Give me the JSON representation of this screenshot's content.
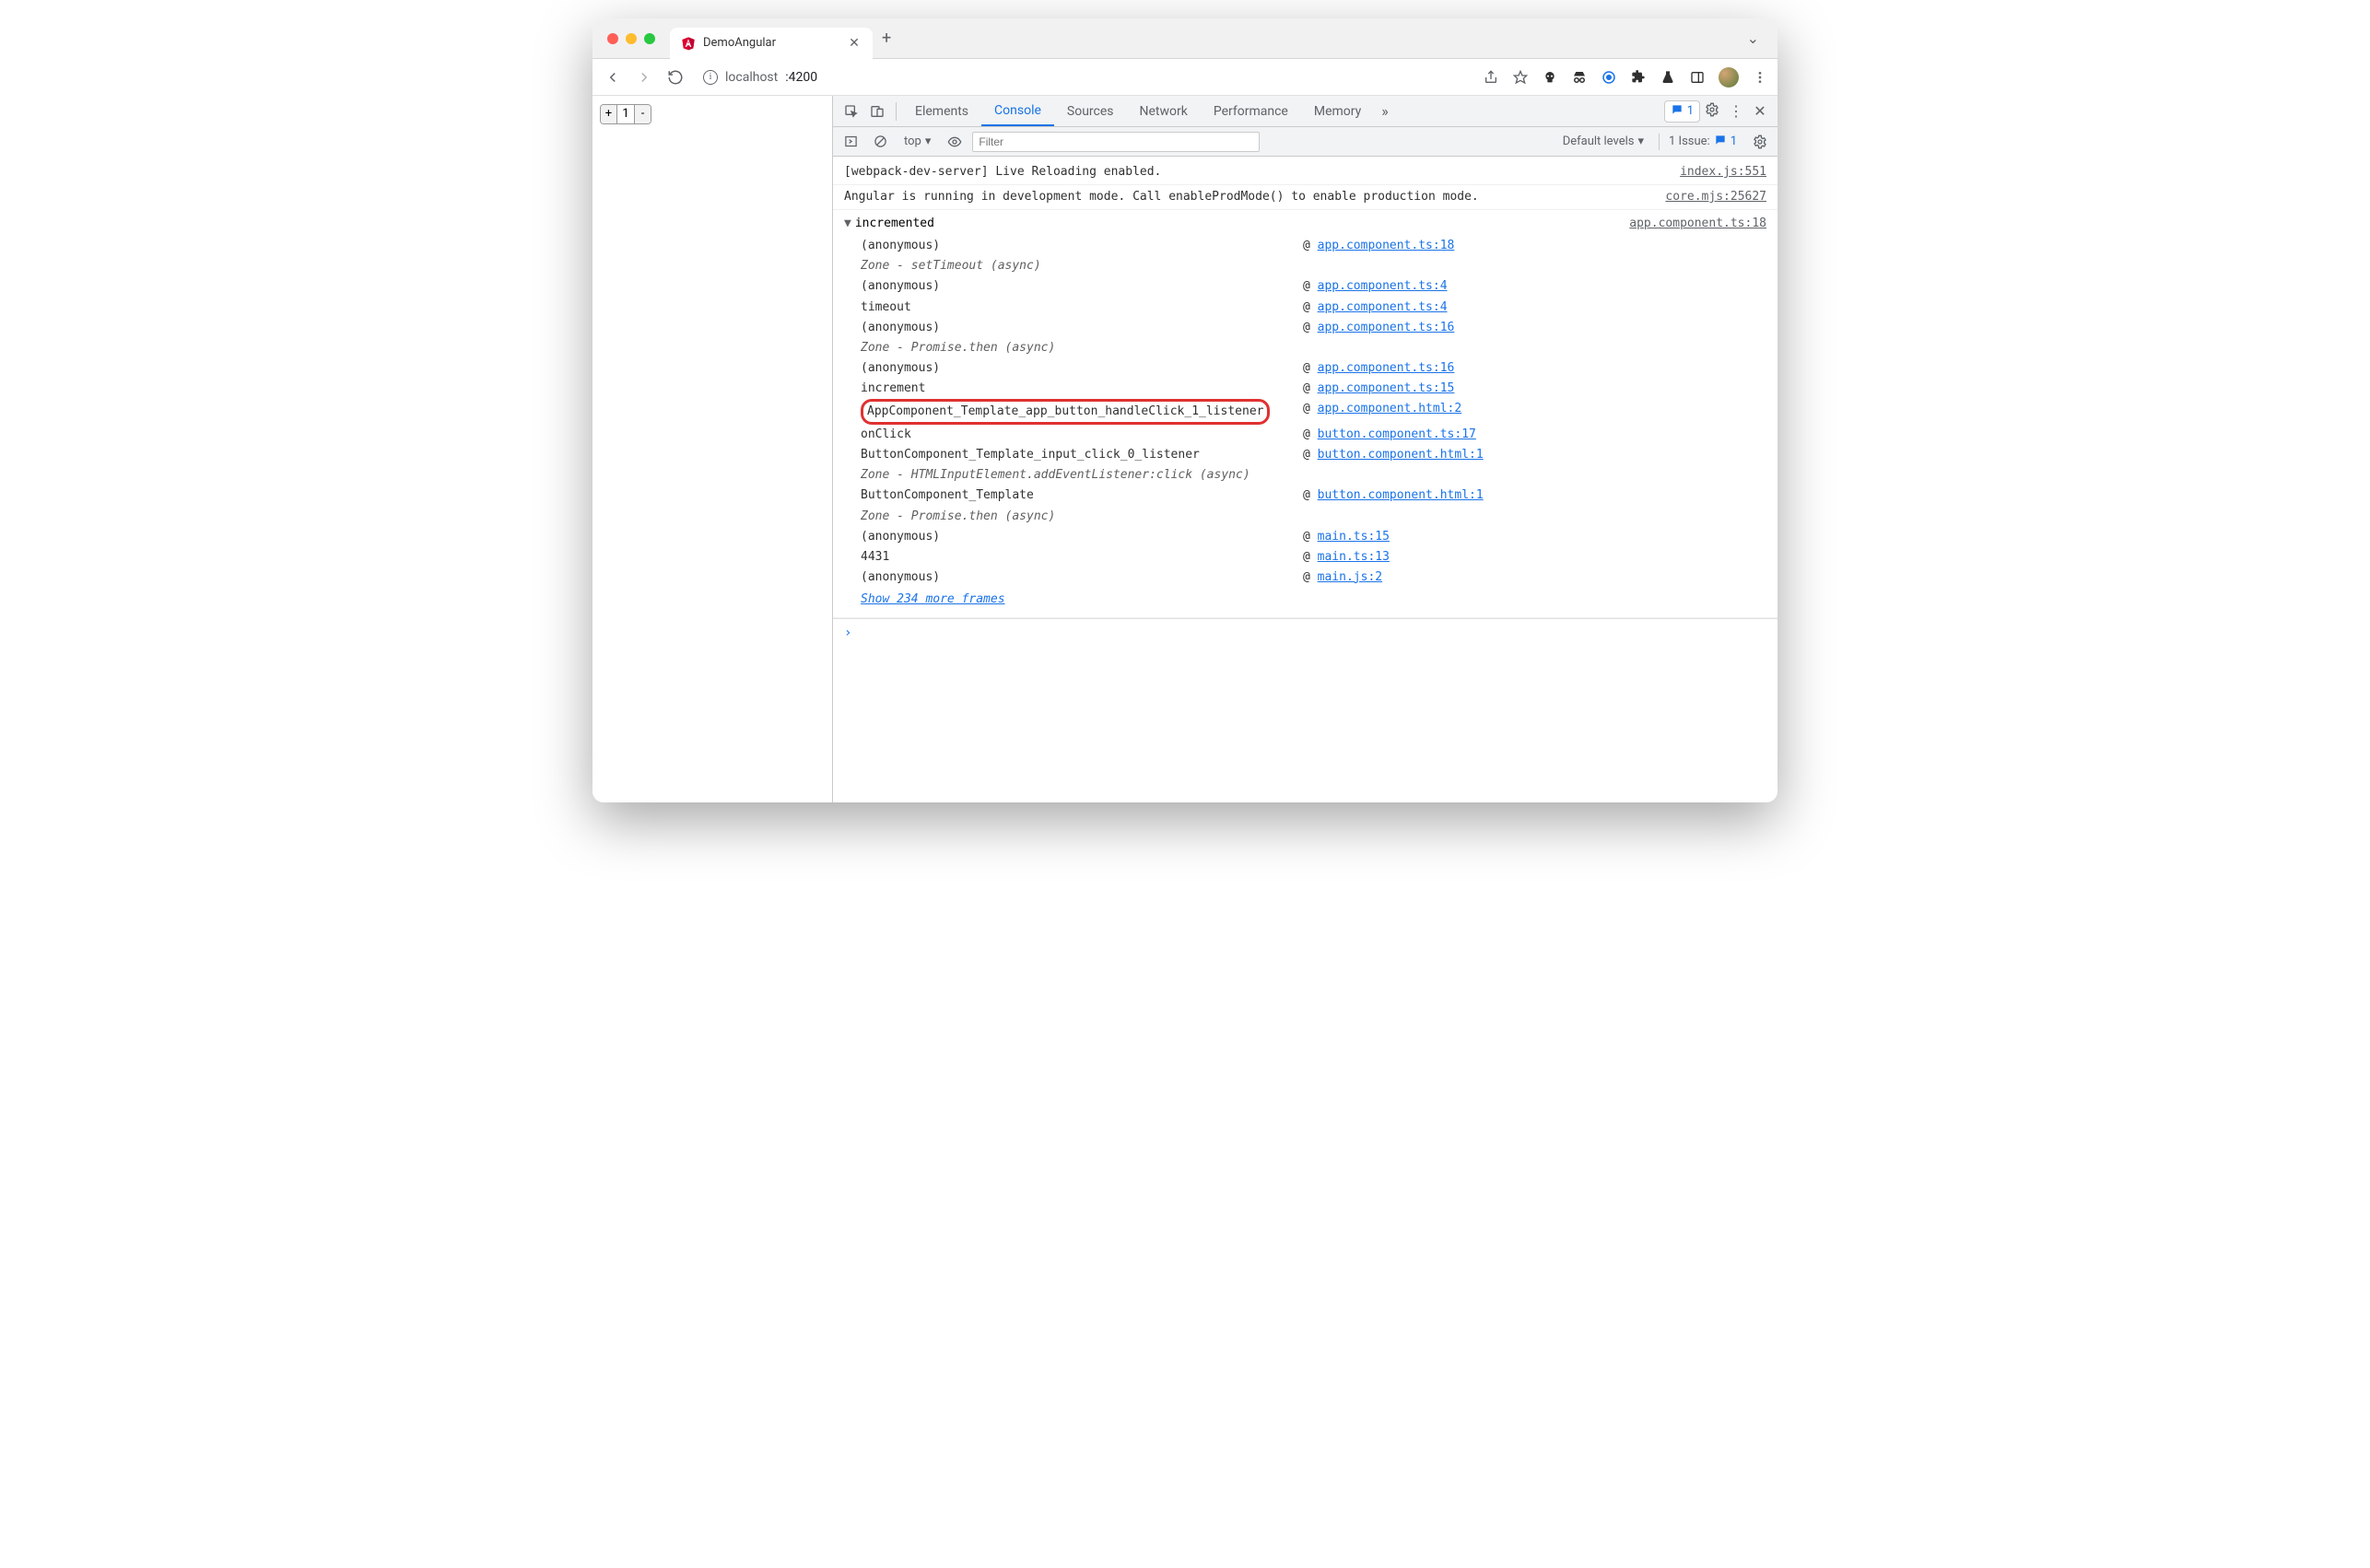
{
  "tab": {
    "title": "DemoAngular"
  },
  "url": {
    "host": "localhost",
    "port": ":4200"
  },
  "counter": {
    "plus": "+",
    "value": "1",
    "minus": "-"
  },
  "devtools": {
    "panels": [
      "Elements",
      "Console",
      "Sources",
      "Network",
      "Performance",
      "Memory"
    ],
    "more": "»",
    "issue_count": "1",
    "toolbar": {
      "context": "top",
      "filter_placeholder": "Filter",
      "levels": "Default levels",
      "issues_prefix": "1 Issue:",
      "issues_count": "1"
    }
  },
  "console": {
    "logs": [
      {
        "text": "[webpack-dev-server] Live Reloading enabled.",
        "source": "index.js:551"
      },
      {
        "text": "Angular is running in development mode. Call enableProdMode() to enable production mode.",
        "source": "core.mjs:25627"
      }
    ],
    "trace": {
      "label": "incremented",
      "source": "app.component.ts:18",
      "frames": [
        {
          "fn": "(anonymous)",
          "link": "app.component.ts:18",
          "zone": false,
          "highlight": false
        },
        {
          "fn": "Zone - setTimeout (async)",
          "link": null,
          "zone": true,
          "highlight": false
        },
        {
          "fn": "(anonymous)",
          "link": "app.component.ts:4",
          "zone": false,
          "highlight": false
        },
        {
          "fn": "timeout",
          "link": "app.component.ts:4",
          "zone": false,
          "highlight": false
        },
        {
          "fn": "(anonymous)",
          "link": "app.component.ts:16",
          "zone": false,
          "highlight": false
        },
        {
          "fn": "Zone - Promise.then (async)",
          "link": null,
          "zone": true,
          "highlight": false
        },
        {
          "fn": "(anonymous)",
          "link": "app.component.ts:16",
          "zone": false,
          "highlight": false
        },
        {
          "fn": "increment",
          "link": "app.component.ts:15",
          "zone": false,
          "highlight": false
        },
        {
          "fn": "AppComponent_Template_app_button_handleClick_1_listener",
          "link": "app.component.html:2",
          "zone": false,
          "highlight": true
        },
        {
          "fn": "onClick",
          "link": "button.component.ts:17",
          "zone": false,
          "highlight": false
        },
        {
          "fn": "ButtonComponent_Template_input_click_0_listener",
          "link": "button.component.html:1",
          "zone": false,
          "highlight": false
        },
        {
          "fn": "Zone - HTMLInputElement.addEventListener:click (async)",
          "link": null,
          "zone": true,
          "highlight": false
        },
        {
          "fn": "ButtonComponent_Template",
          "link": "button.component.html:1",
          "zone": false,
          "highlight": false
        },
        {
          "fn": "Zone - Promise.then (async)",
          "link": null,
          "zone": true,
          "highlight": false
        },
        {
          "fn": "(anonymous)",
          "link": "main.ts:15",
          "zone": false,
          "highlight": false
        },
        {
          "fn": "4431",
          "link": "main.ts:13",
          "zone": false,
          "highlight": false
        },
        {
          "fn": "(anonymous)",
          "link": "main.js:2",
          "zone": false,
          "highlight": false
        }
      ],
      "show_more": "Show 234 more frames"
    },
    "prompt": "›"
  }
}
